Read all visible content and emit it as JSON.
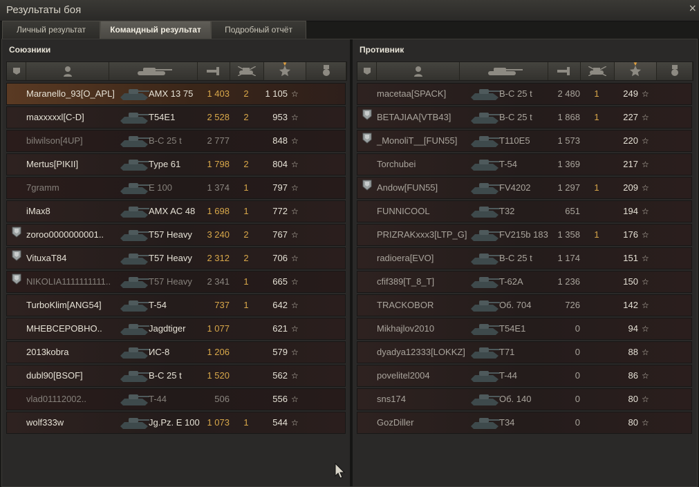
{
  "window": {
    "title": "Результаты боя",
    "close": "×"
  },
  "tabs": [
    {
      "label": "Личный результат",
      "active": false
    },
    {
      "label": "Командный результат",
      "active": true
    },
    {
      "label": "Подробный отчёт",
      "active": false
    }
  ],
  "allies": {
    "title": "Союзники",
    "rows": [
      {
        "name": "Maranello_93[O_APL]",
        "tank": "AMX 13 75",
        "damage": "1 403",
        "kills": "2",
        "xp": "1 105",
        "medal": false,
        "state": "me"
      },
      {
        "name": "maxxxxxl[C-D]",
        "tank": "T54E1",
        "damage": "2 528",
        "kills": "2",
        "xp": "953",
        "medal": false,
        "state": "alive"
      },
      {
        "name": "bilwilson[4UP]",
        "tank": "В-С 25 t",
        "damage": "2 777",
        "kills": "",
        "xp": "848",
        "medal": false,
        "state": "dead"
      },
      {
        "name": "Mertus[PIKII]",
        "tank": "Type 61",
        "damage": "1 798",
        "kills": "2",
        "xp": "804",
        "medal": false,
        "state": "alive"
      },
      {
        "name": "7gramm",
        "tank": "E 100",
        "damage": "1 374",
        "kills": "1",
        "xp": "797",
        "medal": false,
        "state": "dead"
      },
      {
        "name": "iMax8",
        "tank": "AMX AC 48",
        "damage": "1 698",
        "kills": "1",
        "xp": "772",
        "medal": false,
        "state": "alive"
      },
      {
        "name": "zoroo0000000001..",
        "tank": "T57 Heavy",
        "damage": "3 240",
        "kills": "2",
        "xp": "767",
        "medal": true,
        "state": "alive"
      },
      {
        "name": "VituxaT84",
        "tank": "T57 Heavy",
        "damage": "2 312",
        "kills": "2",
        "xp": "706",
        "medal": true,
        "state": "alive"
      },
      {
        "name": "NIKOLIA1111111111..",
        "tank": "T57 Heavy",
        "damage": "2 341",
        "kills": "1",
        "xp": "665",
        "medal": true,
        "state": "dead"
      },
      {
        "name": "TurboKlim[ANG54]",
        "tank": "T-54",
        "damage": "737",
        "kills": "1",
        "xp": "642",
        "medal": false,
        "state": "alive"
      },
      {
        "name": "MHEBCEPOBHO..",
        "tank": "Jagdtiger",
        "damage": "1 077",
        "kills": "",
        "xp": "621",
        "medal": false,
        "state": "alive"
      },
      {
        "name": "2013kobra",
        "tank": "ИС-8",
        "damage": "1 206",
        "kills": "",
        "xp": "579",
        "medal": false,
        "state": "alive"
      },
      {
        "name": "dubl90[BSOF]",
        "tank": "В-С 25 t",
        "damage": "1 520",
        "kills": "",
        "xp": "562",
        "medal": false,
        "state": "alive"
      },
      {
        "name": "vlad01112002..",
        "tank": "T-44",
        "damage": "506",
        "kills": "",
        "xp": "556",
        "medal": false,
        "state": "dead"
      },
      {
        "name": "wolf333w",
        "tank": "Jg.Pz. E 100",
        "damage": "1 073",
        "kills": "1",
        "xp": "544",
        "medal": false,
        "state": "alive"
      }
    ]
  },
  "enemies": {
    "title": "Противник",
    "rows": [
      {
        "name": "macetaa[SPACK]",
        "tank": "В-С 25 t",
        "damage": "2 480",
        "kills": "1",
        "xp": "249",
        "medal": false
      },
      {
        "name": "BETAJIAA[VTB43]",
        "tank": "В-С 25 t",
        "damage": "1 868",
        "kills": "1",
        "xp": "227",
        "medal": true
      },
      {
        "name": "_MonoliT__[FUN55]",
        "tank": "T110E5",
        "damage": "1 573",
        "kills": "",
        "xp": "220",
        "medal": true
      },
      {
        "name": "Torchubei",
        "tank": "T-54",
        "damage": "1 369",
        "kills": "",
        "xp": "217",
        "medal": false
      },
      {
        "name": "Andow[FUN55]",
        "tank": "FV4202",
        "damage": "1 297",
        "kills": "1",
        "xp": "209",
        "medal": true
      },
      {
        "name": "FUNNICOOL",
        "tank": "T32",
        "damage": "651",
        "kills": "",
        "xp": "194",
        "medal": false
      },
      {
        "name": "PRIZRAKxxx3[LTP_G]",
        "tank": "FV215b 183",
        "damage": "1 358",
        "kills": "1",
        "xp": "176",
        "medal": false
      },
      {
        "name": "radioera[EVO]",
        "tank": "В-С 25 t",
        "damage": "1 174",
        "kills": "",
        "xp": "151",
        "medal": false
      },
      {
        "name": "cfif389[T_8_T]",
        "tank": "T-62A",
        "damage": "1 236",
        "kills": "",
        "xp": "150",
        "medal": false
      },
      {
        "name": "TRACKOBOR",
        "tank": "Об. 704",
        "damage": "726",
        "kills": "",
        "xp": "142",
        "medal": false
      },
      {
        "name": "Mikhajlov2010",
        "tank": "T54E1",
        "damage": "0",
        "kills": "",
        "xp": "94",
        "medal": false
      },
      {
        "name": "dyadya12333[LOKKZ]",
        "tank": "T71",
        "damage": "0",
        "kills": "",
        "xp": "88",
        "medal": false
      },
      {
        "name": "povelitel2004",
        "tank": "T-44",
        "damage": "0",
        "kills": "",
        "xp": "86",
        "medal": false
      },
      {
        "name": "sns174",
        "tank": "Об. 140",
        "damage": "0",
        "kills": "",
        "xp": "80",
        "medal": false
      },
      {
        "name": "GozDiller",
        "tank": "T34",
        "damage": "0",
        "kills": "",
        "xp": "80",
        "medal": false
      }
    ]
  },
  "columns": [
    "squad-icon",
    "player-icon",
    "tank-icon",
    "damage-icon",
    "kills-icon",
    "xp-star-icon",
    "medal-icon"
  ],
  "colors": {
    "accent": "#d9a84a",
    "highlight_row": "#5a3a23"
  }
}
